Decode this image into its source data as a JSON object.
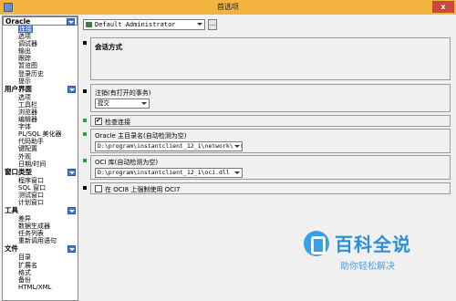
{
  "window": {
    "title": "首选项",
    "close_label": "x"
  },
  "nav": {
    "categories": [
      {
        "label": "Oracle",
        "items": [
          "连接",
          "选项",
          "调试器",
          "输出",
          "跟踪",
          "暂览图",
          "登录历史",
          "提示"
        ]
      },
      {
        "label": "用户界面",
        "items": [
          "选项",
          "工具栏",
          "浏览器",
          "编辑器",
          "字体",
          "PL/SQL 美化器",
          "代码助手",
          "键配置",
          "外观",
          "日期/时间"
        ]
      },
      {
        "label": "窗口类型",
        "items": [
          "程序窗口",
          "SQL 窗口",
          "测试窗口",
          "计划窗口"
        ]
      },
      {
        "label": "工具",
        "items": [
          "差异",
          "数据生成器",
          "任务列表",
          "重新调用语句"
        ]
      },
      {
        "label": "文件",
        "items": [
          "目录",
          "扩展名",
          "格式",
          "备份",
          "HTML/XML"
        ]
      }
    ],
    "selected_item": "连接"
  },
  "profile": {
    "value": "Default Administrator",
    "more_label": "..."
  },
  "session": {
    "title": "会话方式"
  },
  "logoff": {
    "label": "注销(有打开的事务)",
    "value": "提交"
  },
  "check_connection": {
    "label": "检查连接",
    "checked": true
  },
  "oracle_home": {
    "label": "Oracle 主目录名(自动检测为空)",
    "value": "D:\\program\\instantclient_12_1\\network\\adm"
  },
  "oci": {
    "label": "OCI 库(自动检测为空)",
    "value": "D:\\program\\instantclient_12_1\\oci.dll"
  },
  "oci7": {
    "label": "在 OCI8 上强制使用 OCI7",
    "checked": false
  },
  "watermark": {
    "main": "百科全说",
    "sub": "助你轻松解决"
  }
}
